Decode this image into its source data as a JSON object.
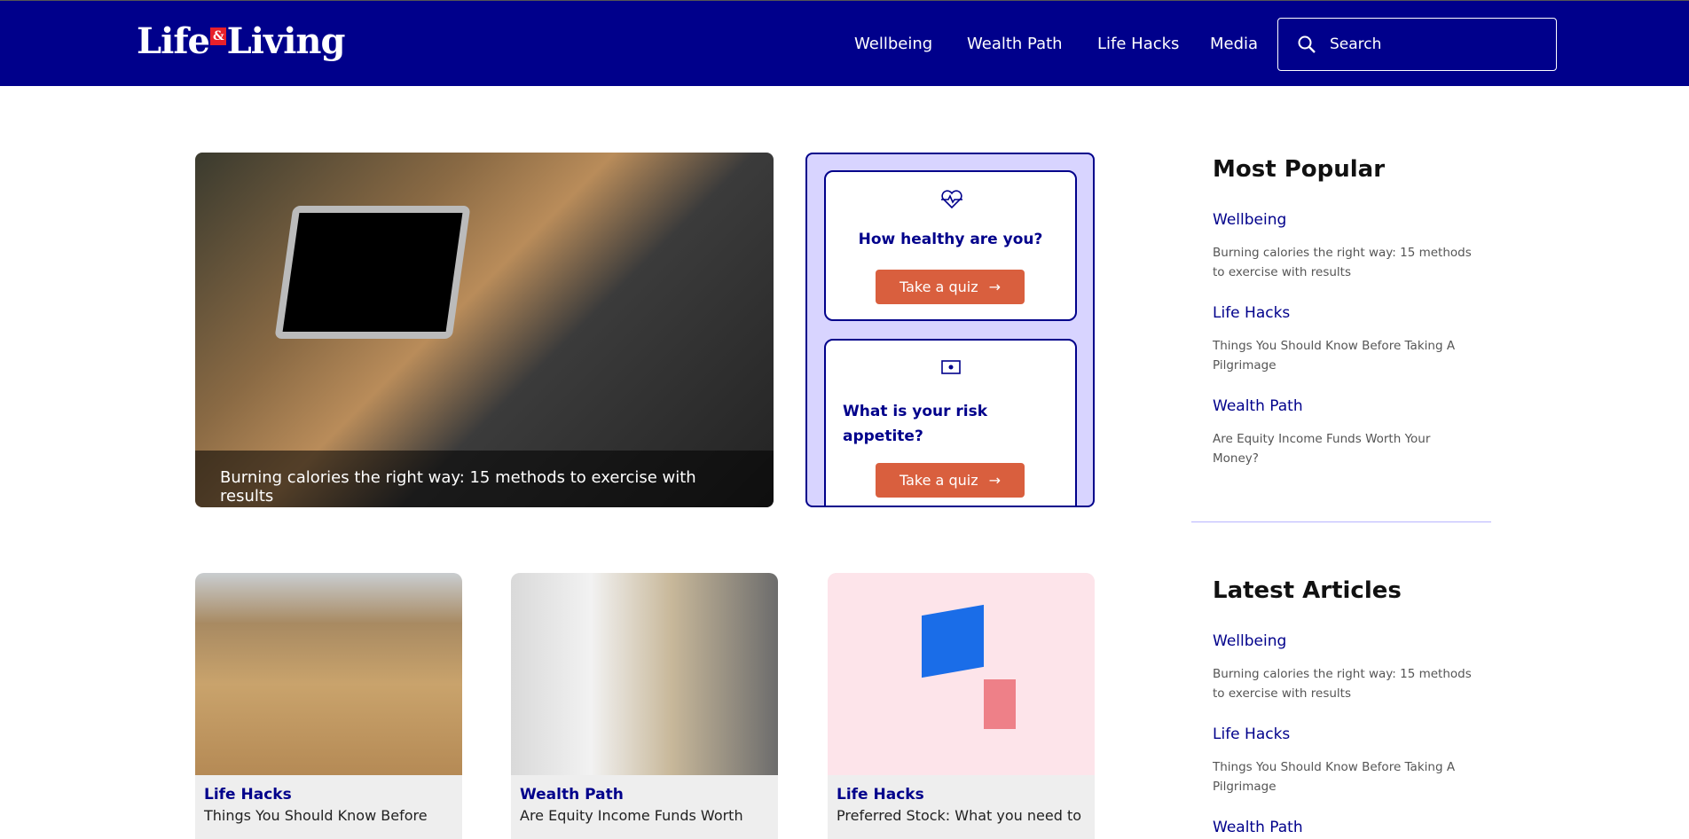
{
  "header": {
    "logo_left": "Life",
    "logo_amp": "&",
    "logo_right": "Living",
    "nav": [
      "Wellbeing",
      "Wealth Path",
      "Life Hacks",
      "Media"
    ],
    "search_placeholder": "Search"
  },
  "hero": {
    "caption": "Burning calories the right way: 15 methods to exercise with results"
  },
  "quizzes": [
    {
      "icon": "heart-pulse-icon",
      "title": "How healthy are you?",
      "button": "Take a quiz"
    },
    {
      "icon": "money-icon",
      "title": "What is your risk appetite?",
      "button": "Take a quiz"
    }
  ],
  "most_popular": {
    "heading": "Most Popular",
    "items": [
      {
        "category": "Wellbeing",
        "title": "Burning calories the right way: 15 methods to exercise with results"
      },
      {
        "category": "Life Hacks",
        "title": "Things You Should Know Before Taking A Pilgrimage"
      },
      {
        "category": "Wealth Path",
        "title": "Are Equity Income Funds Worth Your Money?"
      }
    ]
  },
  "latest": {
    "heading": "Latest Articles",
    "items": [
      {
        "category": "Wellbeing",
        "title": "Burning calories the right way: 15 methods to exercise with results"
      },
      {
        "category": "Life Hacks",
        "title": "Things You Should Know Before Taking A Pilgrimage"
      },
      {
        "category": "Wealth Path"
      }
    ]
  },
  "cards": [
    {
      "category": "Life Hacks",
      "title": "Things You Should Know Before"
    },
    {
      "category": "Wealth Path",
      "title": "Are Equity Income Funds Worth"
    },
    {
      "category": "Life Hacks",
      "title": "Preferred Stock: What you need to"
    }
  ],
  "colors": {
    "brand": "#00008b",
    "accent": "#d95f3e",
    "panel": "#d8d4ff"
  }
}
